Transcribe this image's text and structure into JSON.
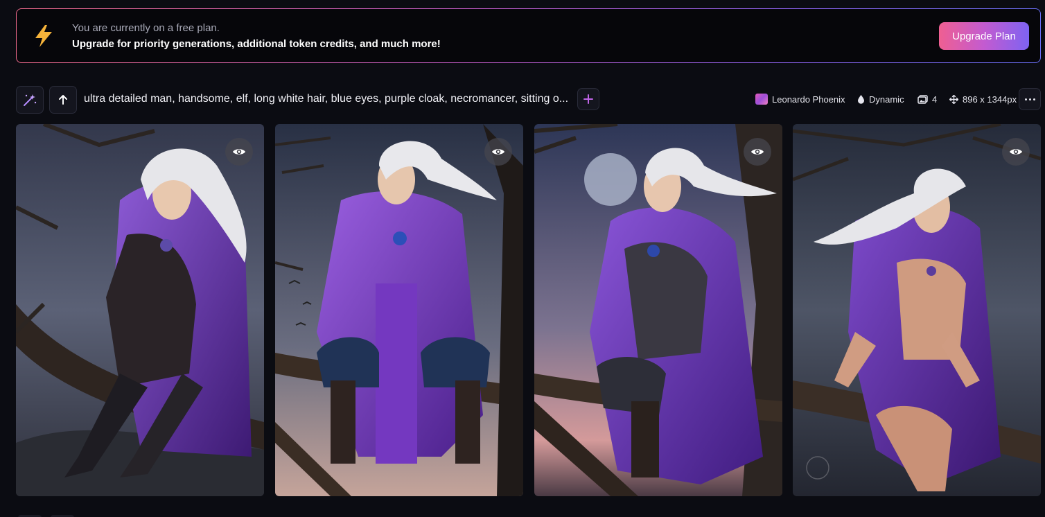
{
  "banner": {
    "line1": "You are currently on a free plan.",
    "line2": "Upgrade for priority generations, additional token credits, and much more!",
    "upgrade_label": "Upgrade Plan",
    "icon": "lightning-bolt-icon",
    "accent_gradient": [
      "#f06a8c",
      "#c35cc9",
      "#6a6ff6"
    ]
  },
  "generation": {
    "prompt": "ultra detailed man, handsome, elf, long white hair, blue eyes, purple cloak, necromancer, sitting o...",
    "model": "Leonardo Phoenix",
    "style": "Dynamic",
    "count": "4",
    "dimensions": "896 x 1344px"
  },
  "images": [
    {
      "name": "generated-image-1",
      "icon": "eye-icon"
    },
    {
      "name": "generated-image-2",
      "icon": "eye-icon"
    },
    {
      "name": "generated-image-3",
      "icon": "eye-icon"
    },
    {
      "name": "generated-image-4",
      "icon": "eye-icon"
    }
  ]
}
